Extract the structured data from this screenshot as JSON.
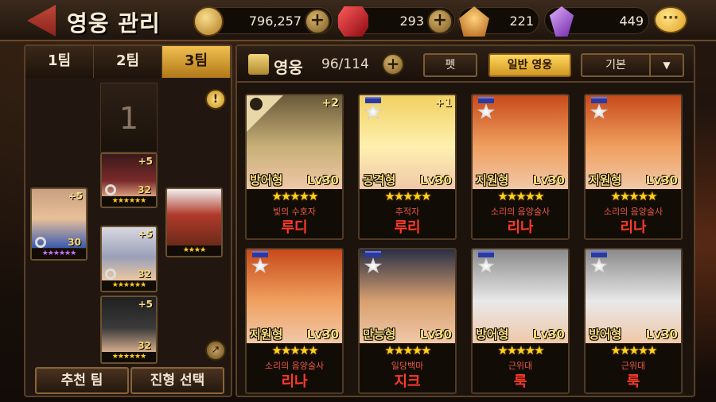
{
  "header": {
    "title": "영웅 관리",
    "resources": [
      {
        "name": "gold",
        "icon": "coin-icon",
        "value": "796,257"
      },
      {
        "name": "ruby",
        "icon": "ruby-icon",
        "value": "293"
      },
      {
        "name": "ore",
        "icon": "ore-icon",
        "value": "221"
      },
      {
        "name": "crystal",
        "icon": "crystal-icon",
        "value": "449"
      }
    ],
    "plus": "+",
    "chat": "···"
  },
  "team": {
    "tabs": [
      "1팀",
      "2팀",
      "3팀"
    ],
    "active_tab": 2,
    "slot_number": "1",
    "info": "!",
    "arrow": "↗",
    "members": [
      {
        "plus": "+5",
        "level": "32",
        "stars": "★★★★★★"
      },
      {
        "plus": "+5",
        "level": "32",
        "stars": "★★★★★★"
      },
      {
        "plus": "+5",
        "level": "32",
        "stars": "★★★★★★"
      },
      {
        "plus": "+5",
        "level": "30",
        "stars": "★★★★★★"
      },
      {
        "plus": "",
        "level": "",
        "stars": "★★★★"
      }
    ],
    "buttons": {
      "recommend": "추천 팀",
      "formation": "진형 선택"
    }
  },
  "hero_list": {
    "label": "영웅",
    "count": "96/114",
    "buttons": {
      "pet": "펫",
      "normal": "일반 영웅",
      "sort": "기본",
      "dropdown": "▼"
    },
    "cards": [
      {
        "class": "방어형",
        "level": "Lv30",
        "stars": "★★★★★",
        "title": "빛의 수호자",
        "name": "루디",
        "plus": "+2",
        "locked": true,
        "medal": false,
        "colors": [
          "#6a5a3a",
          "#c8b078"
        ]
      },
      {
        "class": "공격형",
        "level": "Lv30",
        "stars": "★★★★★",
        "title": "추적자",
        "name": "루리",
        "plus": "+1",
        "locked": false,
        "medal": true,
        "colors": [
          "#f0d060",
          "#fff0b0"
        ]
      },
      {
        "class": "지원형",
        "level": "Lv30",
        "stars": "★★★★★",
        "title": "소리의 음양술사",
        "name": "리나",
        "plus": "",
        "locked": false,
        "medal": true,
        "colors": [
          "#c84a1a",
          "#f0a060"
        ]
      },
      {
        "class": "지원형",
        "level": "Lv30",
        "stars": "★★★★★",
        "title": "소리의 음양술사",
        "name": "리나",
        "plus": "",
        "locked": false,
        "medal": true,
        "colors": [
          "#c84a1a",
          "#f0a060"
        ]
      },
      {
        "class": "지원형",
        "level": "Lv30",
        "stars": "★★★★★",
        "title": "소리의 음양술사",
        "name": "리나",
        "plus": "",
        "locked": false,
        "medal": true,
        "colors": [
          "#c84a1a",
          "#f0a060"
        ]
      },
      {
        "class": "만능형",
        "level": "Lv30",
        "stars": "★★★★★",
        "title": "일당백마",
        "name": "지크",
        "plus": "",
        "locked": false,
        "medal": true,
        "colors": [
          "#2a3046",
          "#d8a070"
        ]
      },
      {
        "class": "방어형",
        "level": "Lv30",
        "stars": "★★★★★",
        "title": "근위대",
        "name": "룩",
        "plus": "",
        "locked": false,
        "medal": true,
        "colors": [
          "#8a8a8a",
          "#e8e8e8"
        ]
      },
      {
        "class": "방어형",
        "level": "Lv30",
        "stars": "★★★★★",
        "title": "근위대",
        "name": "룩",
        "plus": "",
        "locked": false,
        "medal": true,
        "colors": [
          "#8a8a8a",
          "#e8e8e8"
        ]
      }
    ]
  }
}
